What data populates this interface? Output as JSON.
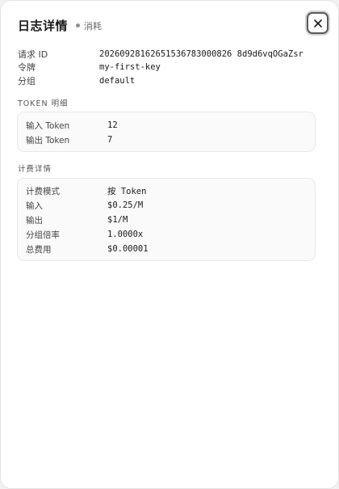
{
  "dialog": {
    "title": "日志详情",
    "status": "消耗",
    "close_icon": "close-icon"
  },
  "meta": [
    {
      "label": "请求 ID",
      "value": "20260928162651536783000826 8d9d6vqOGaZsr"
    },
    {
      "label": "令牌",
      "value": "my-first-key"
    },
    {
      "label": "分组",
      "value": "default"
    }
  ],
  "token_section": {
    "title": "TOKEN 明细",
    "rows": [
      {
        "label": "输入 Token",
        "value": "12"
      },
      {
        "label": "输出 Token",
        "value": "7"
      }
    ]
  },
  "billing_section": {
    "title": "计费详情",
    "rows": [
      {
        "label": "计费模式",
        "value": "按 Token"
      },
      {
        "label": "输入",
        "value": "$0.25/M"
      },
      {
        "label": "输出",
        "value": "$1/M"
      },
      {
        "label": "分组倍率",
        "value": "1.0000x"
      },
      {
        "label": "总费用",
        "value": "$0.00001"
      }
    ]
  }
}
